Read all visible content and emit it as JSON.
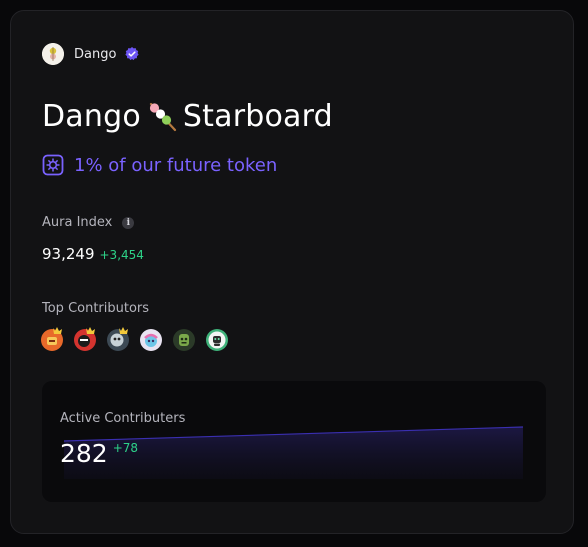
{
  "org": {
    "name": "Dango",
    "verified": true,
    "avatar_icon": "dango-logo-icon",
    "verified_icon": "verified-badge-icon"
  },
  "title": {
    "before": "Dango",
    "emoji_icon": "dango-skewer-icon",
    "after": "Starboard"
  },
  "token": {
    "icon": "token-box-icon",
    "text": "1% of our future token"
  },
  "aura": {
    "label": "Aura Index",
    "info_icon": "info-icon",
    "value": "93,249",
    "delta": "+3,454"
  },
  "top_contributors": {
    "label": "Top Contributors",
    "avatars": [
      {
        "icon": "crowned-avatar-orange-icon"
      },
      {
        "icon": "crowned-avatar-red-icon"
      },
      {
        "icon": "crowned-avatar-gray-icon"
      },
      {
        "icon": "avatar-colorful-icon"
      },
      {
        "icon": "avatar-green-icon"
      },
      {
        "icon": "avatar-robot-icon"
      }
    ]
  },
  "active": {
    "label": "Active Contributers",
    "value": "282",
    "delta": "+78"
  },
  "colors": {
    "accent": "#7a62ff",
    "positive": "#2dd389",
    "background": "#121214"
  }
}
